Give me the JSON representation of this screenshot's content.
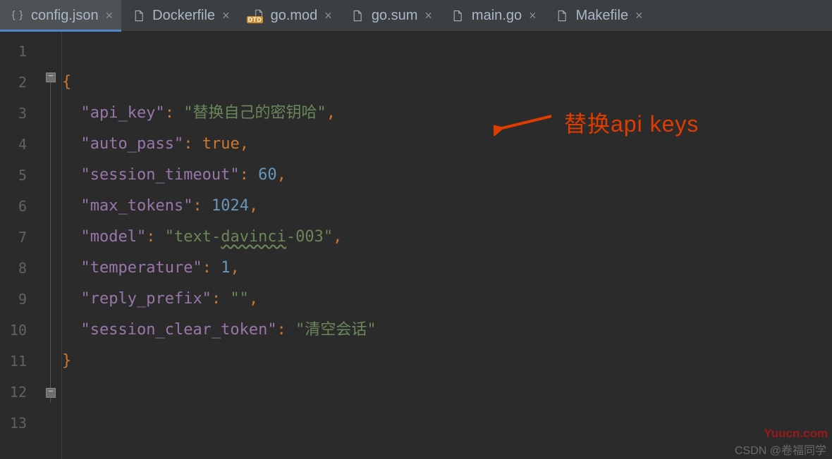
{
  "tabs": [
    {
      "label": "config.json",
      "kind": "json",
      "active": true
    },
    {
      "label": "Dockerfile",
      "kind": "generic",
      "active": false
    },
    {
      "label": "go.mod",
      "kind": "dtd",
      "active": false
    },
    {
      "label": "go.sum",
      "kind": "generic",
      "active": false
    },
    {
      "label": "main.go",
      "kind": "generic",
      "active": false
    },
    {
      "label": "Makefile",
      "kind": "generic",
      "active": false
    }
  ],
  "line_numbers": [
    "1",
    "2",
    "3",
    "4",
    "5",
    "6",
    "7",
    "8",
    "9",
    "10",
    "11",
    "12",
    "13"
  ],
  "json_entries": [
    {
      "key": "api_key",
      "value": "替换自己的密钥哈",
      "type": "string"
    },
    {
      "key": "auto_pass",
      "value": "true",
      "type": "bool"
    },
    {
      "key": "session_timeout",
      "value": "60",
      "type": "number"
    },
    {
      "key": "max_tokens",
      "value": "1024",
      "type": "number"
    },
    {
      "key": "model",
      "value": "text-davinci-003",
      "type": "string",
      "typo_part": "davinci"
    },
    {
      "key": "temperature",
      "value": "1",
      "type": "number"
    },
    {
      "key": "reply_prefix",
      "value": "",
      "type": "string"
    },
    {
      "key": "session_clear_token",
      "value": "清空会话",
      "type": "string"
    }
  ],
  "dtd_label": "DTD",
  "annotation": "替换api keys",
  "watermark_right": "Yuucn.com",
  "watermark_bottom": "CSDN @卷福同学"
}
